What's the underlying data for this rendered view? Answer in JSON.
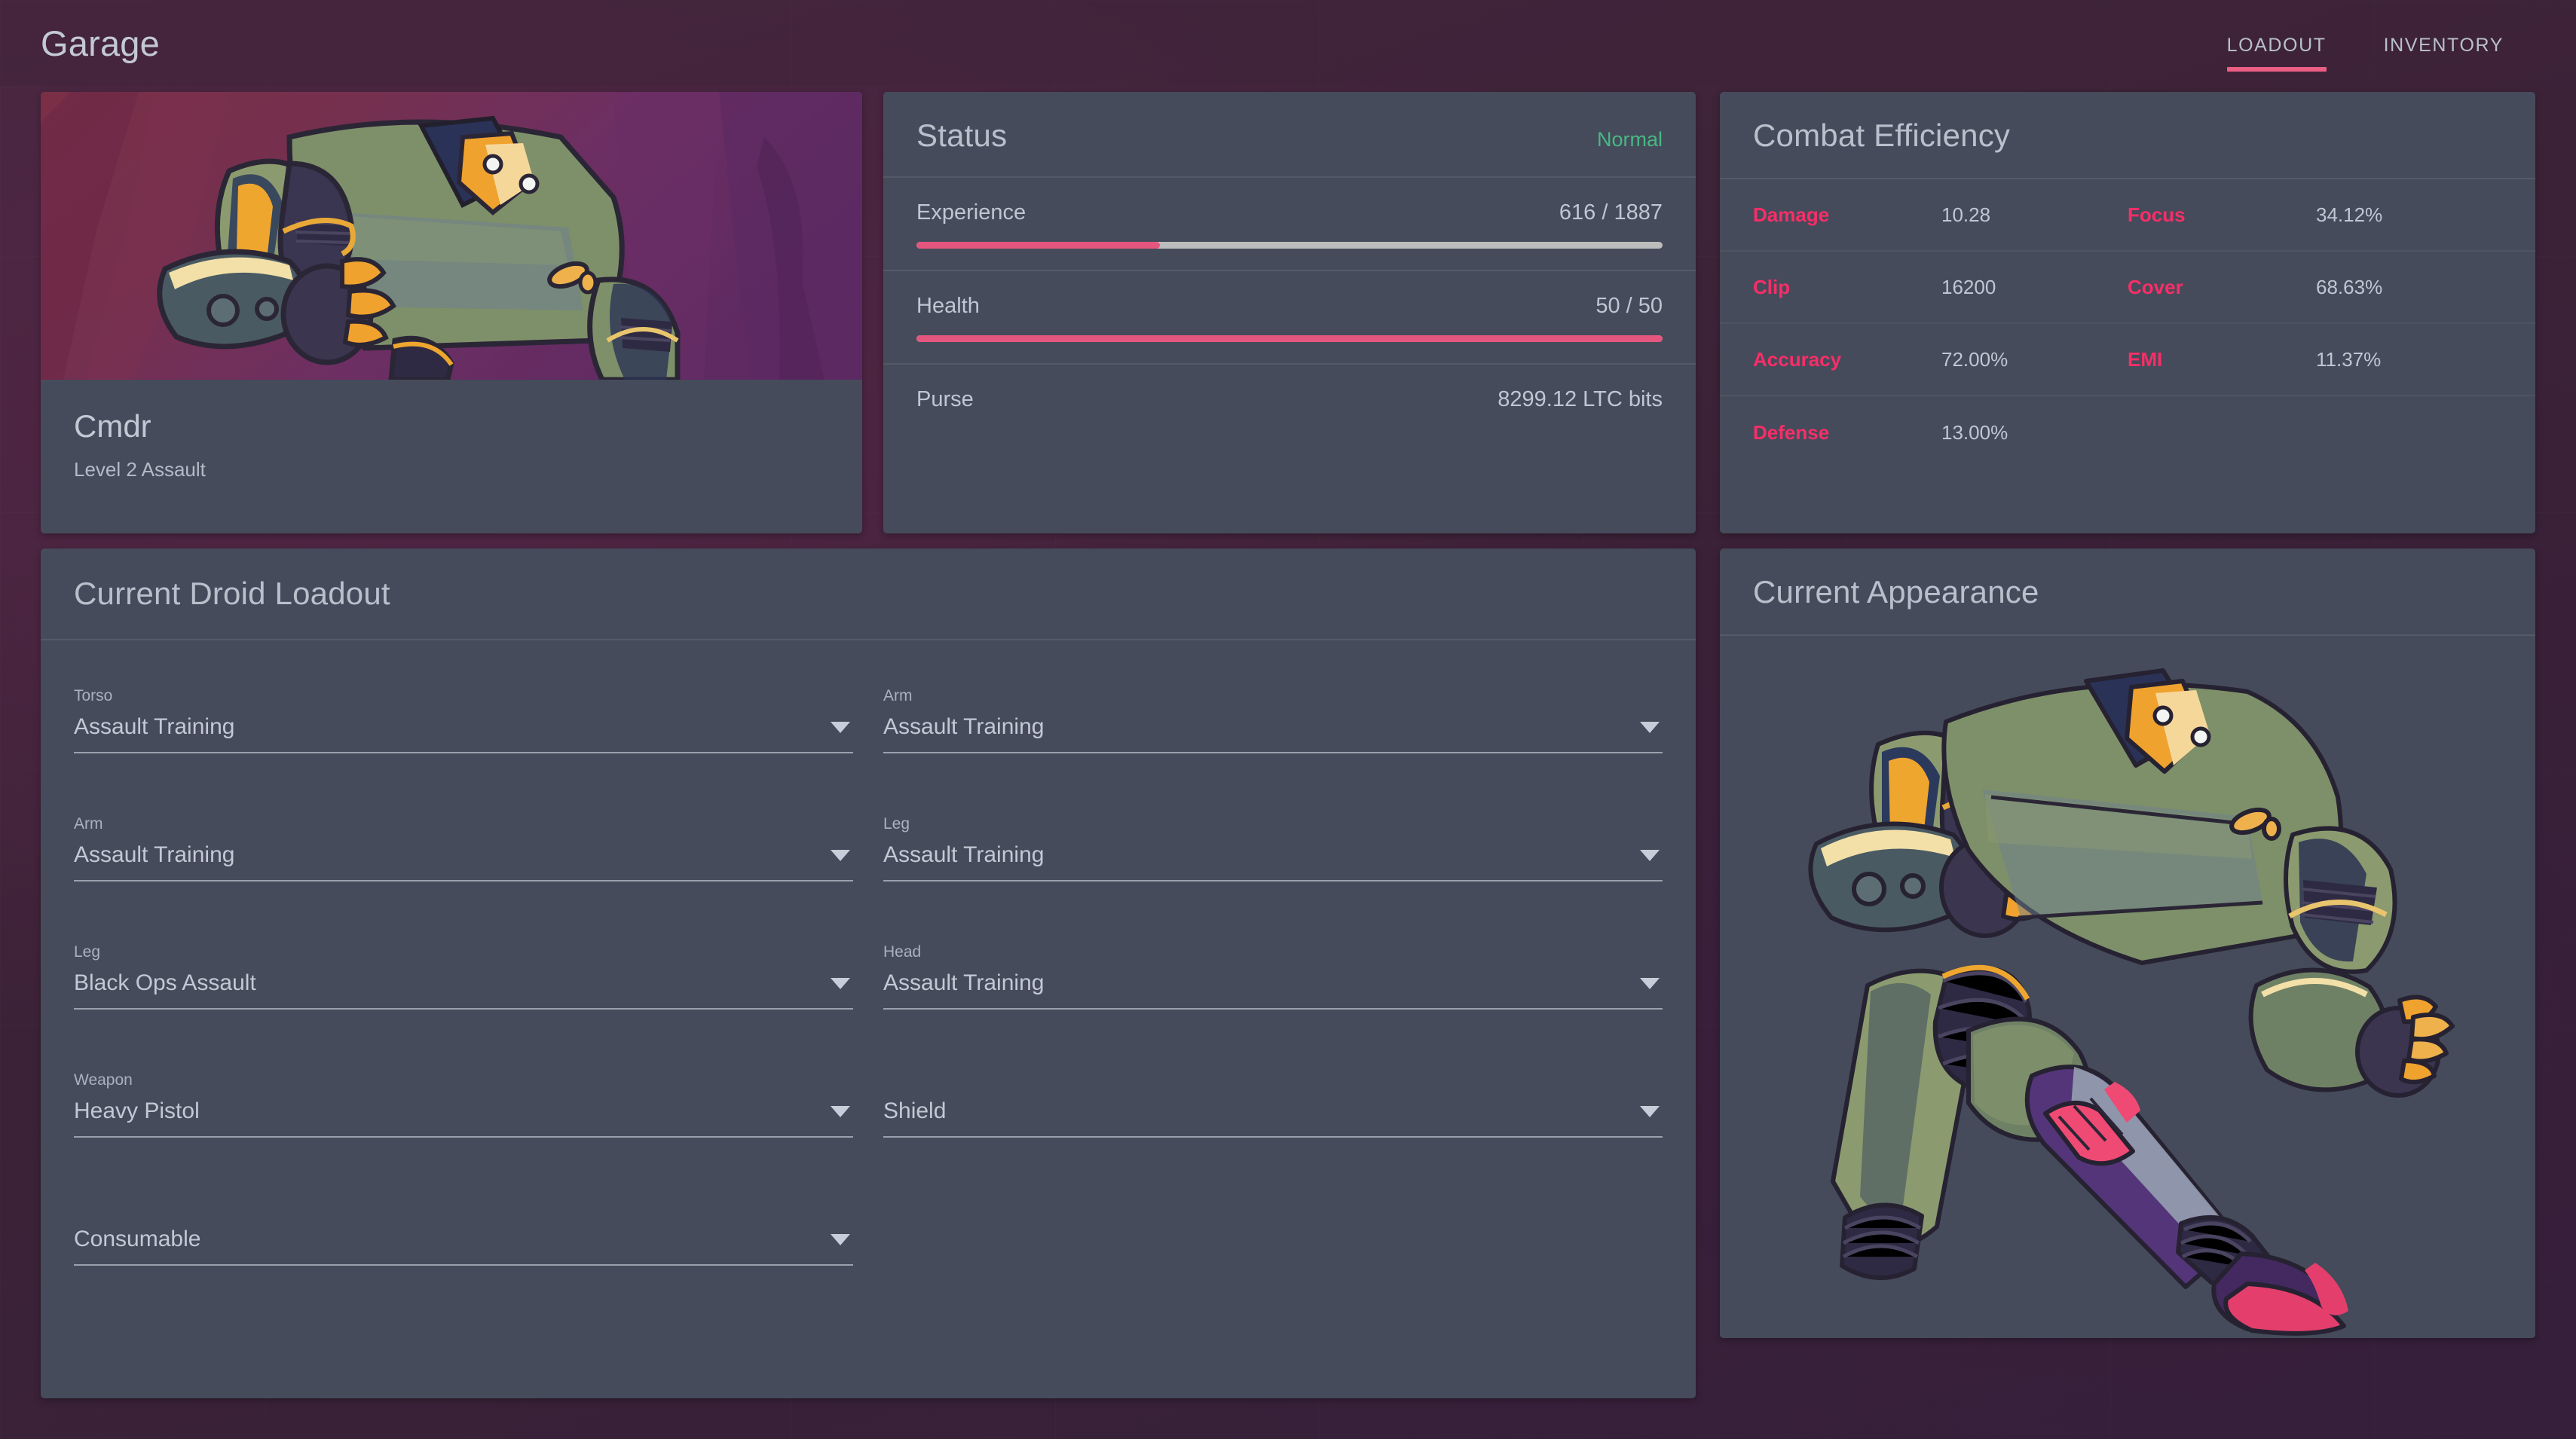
{
  "header": {
    "title": "Garage",
    "tabs": [
      {
        "label": "LOADOUT",
        "active": true
      },
      {
        "label": "INVENTORY",
        "active": false
      }
    ]
  },
  "avatar": {
    "name": "Cmdr",
    "subtitle": "Level 2 Assault",
    "art_name": "droid-portrait-art"
  },
  "status": {
    "title": "Status",
    "condition": "Normal",
    "condition_color": "#48b883",
    "rows": [
      {
        "label": "Experience",
        "value": "616 / 1887",
        "fill_pct": 32.6,
        "has_bar": true
      },
      {
        "label": "Health",
        "value": "50 / 50",
        "fill_pct": 100,
        "has_bar": true
      },
      {
        "label": "Purse",
        "value": "8299.12 LTC bits",
        "fill_pct": 0,
        "has_bar": false
      }
    ],
    "bar_fill_color": "#e5567f",
    "bar_track_color": "#bcbdbd"
  },
  "combat": {
    "title": "Combat Efficiency",
    "label_color": "#f72e68",
    "rows": [
      [
        {
          "key": "Damage",
          "value": "10.28"
        },
        {
          "key": "Focus",
          "value": "34.12%"
        }
      ],
      [
        {
          "key": "Clip",
          "value": "16200"
        },
        {
          "key": "Cover",
          "value": "68.63%"
        }
      ],
      [
        {
          "key": "Accuracy",
          "value": "72.00%"
        },
        {
          "key": "EMI",
          "value": "11.37%"
        }
      ],
      [
        {
          "key": "Defense",
          "value": "13.00%"
        },
        {
          "key": "",
          "value": ""
        }
      ]
    ]
  },
  "loadout": {
    "title": "Current Droid Loadout",
    "slots": [
      {
        "label": "Torso",
        "value": "Assault Training",
        "is_placeholder": false
      },
      {
        "label": "Arm",
        "value": "Assault Training",
        "is_placeholder": false
      },
      {
        "label": "Arm",
        "value": "Assault Training",
        "is_placeholder": false
      },
      {
        "label": "Leg",
        "value": "Assault Training",
        "is_placeholder": false
      },
      {
        "label": "Leg",
        "value": "Black Ops Assault",
        "is_placeholder": false
      },
      {
        "label": "Head",
        "value": "Assault Training",
        "is_placeholder": false
      },
      {
        "label": "Weapon",
        "value": "Heavy Pistol",
        "is_placeholder": false
      },
      {
        "label": "",
        "value": "Shield",
        "is_placeholder": true
      },
      {
        "label": "",
        "value": "Consumable",
        "is_placeholder": true
      }
    ]
  },
  "appearance": {
    "title": "Current Appearance",
    "art_name": "droid-full-body-art"
  },
  "theme": {
    "panel_bg": "#454b5a",
    "accent_pink": "#ec5f84",
    "text_primary": "#c3c9d4",
    "page_bg": "#3e2338"
  }
}
